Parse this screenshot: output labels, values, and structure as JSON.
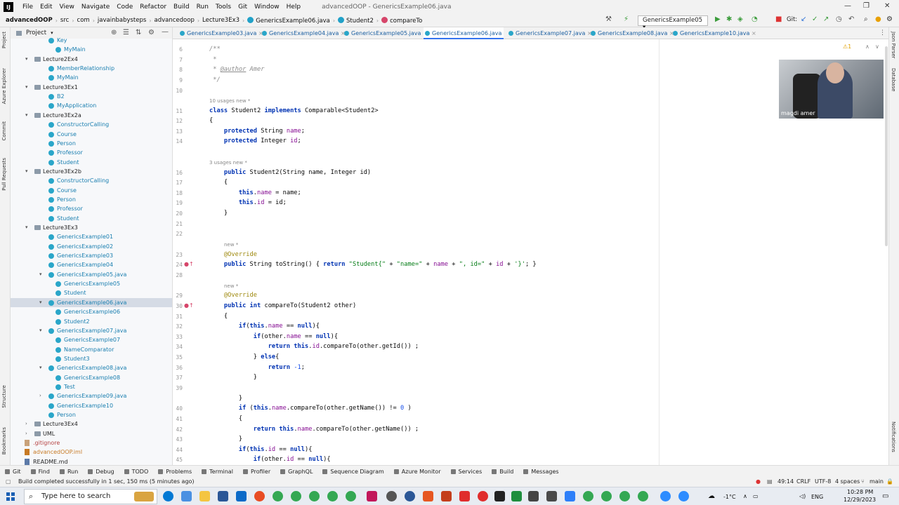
{
  "menubar": {
    "items": [
      "File",
      "Edit",
      "View",
      "Navigate",
      "Code",
      "Refactor",
      "Build",
      "Run",
      "Tools",
      "Git",
      "Window",
      "Help"
    ],
    "window_title": "advancedOOP - GenericsExample06.java"
  },
  "navbar": {
    "crumbs": [
      "advancedOOP",
      "src",
      "com",
      "javainbabysteps",
      "advancedoop",
      "Lecture3Ex3",
      "GenericsExample06.java",
      "Student2",
      "compareTo"
    ],
    "run_config": "GenericsExample05",
    "git_label": "Git:"
  },
  "left_strip": [
    "Project",
    "Azure Explorer",
    "Commit",
    "Pull Requests",
    "Structure",
    "Bookmarks"
  ],
  "right_strip": [
    "Json Parser",
    "Database",
    "Notifications"
  ],
  "project": {
    "header": "Project",
    "tree": [
      {
        "label": "Key",
        "kind": "cls"
      },
      {
        "label": "MyMain",
        "kind": "cls"
      },
      {
        "label": "Lecture2Ex4",
        "kind": "pkg"
      },
      {
        "label": "MemberRelationship",
        "kind": "cls"
      },
      {
        "label": "MyMain",
        "kind": "cls"
      },
      {
        "label": "Lecture3Ex1",
        "kind": "pkg"
      },
      {
        "label": "B2",
        "kind": "cls"
      },
      {
        "label": "MyApplication",
        "kind": "cls"
      },
      {
        "label": "Lecture3Ex2a",
        "kind": "pkg"
      },
      {
        "label": "ConstructorCalling",
        "kind": "cls"
      },
      {
        "label": "Course",
        "kind": "cls"
      },
      {
        "label": "Person",
        "kind": "cls"
      },
      {
        "label": "Professor",
        "kind": "cls"
      },
      {
        "label": "Student",
        "kind": "cls"
      },
      {
        "label": "Lecture3Ex2b",
        "kind": "pkg"
      },
      {
        "label": "ConstructorCalling",
        "kind": "cls"
      },
      {
        "label": "Course",
        "kind": "cls"
      },
      {
        "label": "Person",
        "kind": "cls"
      },
      {
        "label": "Professor",
        "kind": "cls"
      },
      {
        "label": "Student",
        "kind": "cls"
      },
      {
        "label": "Lecture3Ex3",
        "kind": "pkg"
      },
      {
        "label": "GenericsExample01",
        "kind": "cls"
      },
      {
        "label": "GenericsExample02",
        "kind": "cls"
      },
      {
        "label": "GenericsExample03",
        "kind": "cls"
      },
      {
        "label": "GenericsExample04",
        "kind": "cls"
      },
      {
        "label": "GenericsExample05.java",
        "kind": "java"
      },
      {
        "label": "GenericsExample05",
        "kind": "cls"
      },
      {
        "label": "Student",
        "kind": "cls"
      },
      {
        "label": "GenericsExample06.java",
        "kind": "java"
      },
      {
        "label": "GenericsExample06",
        "kind": "cls"
      },
      {
        "label": "Student2",
        "kind": "cls"
      },
      {
        "label": "GenericsExample07.java",
        "kind": "java"
      },
      {
        "label": "GenericsExample07",
        "kind": "cls"
      },
      {
        "label": "NameComparator",
        "kind": "cls"
      },
      {
        "label": "Student3",
        "kind": "cls"
      },
      {
        "label": "GenericsExample08.java",
        "kind": "java"
      },
      {
        "label": "GenericsExample08",
        "kind": "cls"
      },
      {
        "label": "Test",
        "kind": "cls"
      },
      {
        "label": "GenericsExample09.java",
        "kind": "java"
      },
      {
        "label": "GenericsExample10",
        "kind": "cls"
      },
      {
        "label": "Person",
        "kind": "cls"
      },
      {
        "label": "Lecture3Ex4",
        "kind": "pkg"
      },
      {
        "label": "UML",
        "kind": "pkg"
      },
      {
        "label": ".gitignore",
        "kind": "git"
      },
      {
        "label": "advancedOOP.iml",
        "kind": "iml"
      },
      {
        "label": "README.md",
        "kind": "md"
      }
    ]
  },
  "tabs": [
    "GenericsExample03.java",
    "GenericsExample04.java",
    "GenericsExample05.java",
    "GenericsExample06.java",
    "GenericsExample07.java",
    "GenericsExample08.java",
    "GenericsExample10.java"
  ],
  "active_tab": "GenericsExample06.java",
  "editor": {
    "line_numbers": [
      "6",
      "7",
      "8",
      "9",
      "10",
      "11",
      "12",
      "13",
      "14",
      "16",
      "17",
      "18",
      "19",
      "20",
      "21",
      "22",
      "23",
      "24",
      "28",
      "29",
      "30",
      "31",
      "32",
      "33",
      "34",
      "35",
      "36",
      "37",
      "39",
      "40",
      "41",
      "42",
      "43",
      "44",
      "45"
    ],
    "hints": {
      "h1": "10 usages   new *",
      "h2": "3 usages   new *",
      "h3": "new *",
      "h4": "new *"
    }
  },
  "video": {
    "name": "magdi amer"
  },
  "toolwindows": [
    "Git",
    "Find",
    "Run",
    "Debug",
    "TODO",
    "Problems",
    "Terminal",
    "Profiler",
    "GraphQL",
    "Sequence Diagram",
    "Azure Monitor",
    "Services",
    "Build",
    "Messages"
  ],
  "status": {
    "message": "Build completed successfully in 1 sec, 150 ms (5 minutes ago)",
    "position": "49:14",
    "line_sep": "CRLF",
    "encoding": "UTF-8",
    "indent": "4 spaces",
    "branch": "main"
  },
  "taskbar": {
    "search_placeholder": "Type here to search",
    "weather": "-1°C",
    "lang": "ENG",
    "time": "10:28 PM",
    "date": "12/29/2023"
  },
  "colors": {
    "accent": "#3574f0",
    "selection": "#d5dbe5",
    "keyword": "#0033b3",
    "string": "#067d17"
  }
}
